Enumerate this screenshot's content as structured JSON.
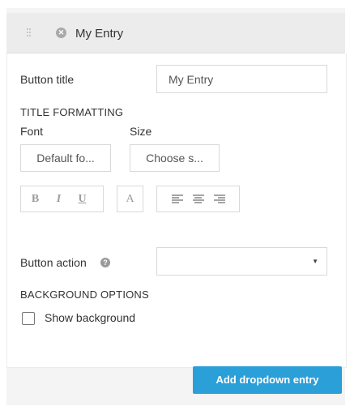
{
  "entry": {
    "title": "My Entry",
    "button_title_label": "Button title",
    "button_title_value": "My Entry",
    "title_formatting_label": "TITLE FORMATTING",
    "font_label": "Font",
    "size_label": "Size",
    "font_value": "Default fo...",
    "size_value": "Choose s...",
    "format": {
      "bold": "B",
      "italic": "I",
      "underline": "U",
      "color": "A"
    },
    "button_action_label": "Button action",
    "button_action_value": "",
    "background_options_label": "BACKGROUND OPTIONS",
    "show_background_label": "Show background",
    "show_background_checked": false
  },
  "footer": {
    "add_button_label": "Add dropdown entry"
  },
  "colors": {
    "primary": "#2a9fd8",
    "panel": "#f4f4f4",
    "header": "#ececec",
    "border": "#d9d9d9"
  }
}
